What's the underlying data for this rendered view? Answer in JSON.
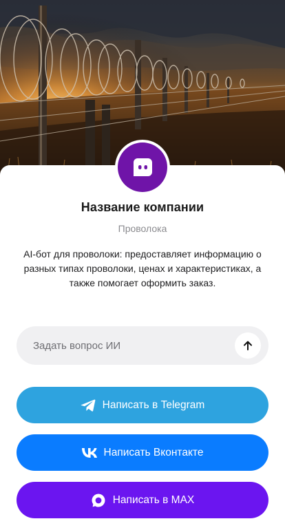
{
  "company": {
    "name": "Название компании",
    "subtitle": "Проволока",
    "description": "AI-бот для проволоки: предоставляет информацию о разных типах проволоки, ценах и характеристиках, а также помогает оформить заказ."
  },
  "ask": {
    "placeholder": "Задать вопрос ИИ"
  },
  "buttons": {
    "telegram": {
      "label": "Написать в Telegram",
      "color": "#2ea3df",
      "icon": "telegram-icon"
    },
    "vk": {
      "label": "Написать Вконтакте",
      "color": "#0a7cff",
      "icon": "vk-icon"
    },
    "max": {
      "label": "Написать в MAX",
      "color": "#6b15f0",
      "icon": "max-icon"
    }
  },
  "avatar": {
    "color": "#6f14a8",
    "icon": "chat-bot-icon"
  }
}
